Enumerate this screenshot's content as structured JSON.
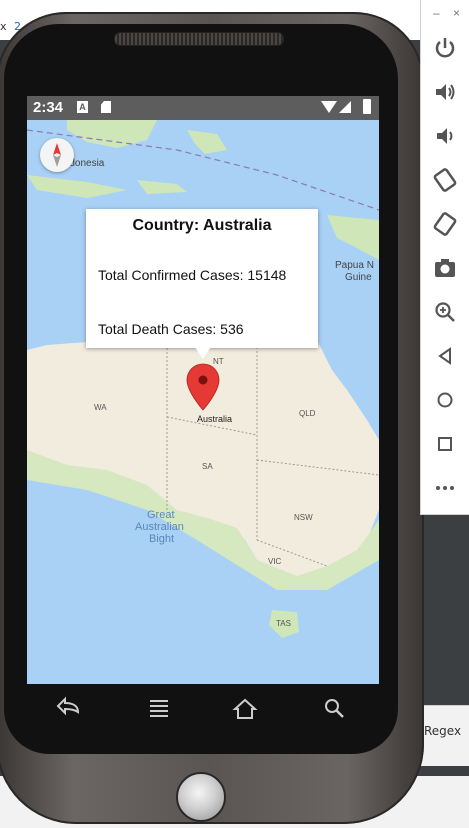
{
  "ide": {
    "tab_fragment_left": "x",
    "tab_fragment_right": "2",
    "search_option_label": "Regex"
  },
  "toolbar": {
    "minimize_label": "–",
    "close_label": "×",
    "buttons": [
      {
        "icon": "power-icon"
      },
      {
        "icon": "volume-up-icon"
      },
      {
        "icon": "volume-down-icon"
      },
      {
        "icon": "rotate-left-icon"
      },
      {
        "icon": "rotate-right-icon"
      },
      {
        "icon": "camera-icon"
      },
      {
        "icon": "zoom-icon"
      },
      {
        "icon": "back-icon"
      },
      {
        "icon": "home-icon"
      },
      {
        "icon": "overview-icon"
      },
      {
        "icon": "more-icon"
      }
    ]
  },
  "status_bar": {
    "time": "2:34",
    "notification_icon_text": "A"
  },
  "map": {
    "labels": {
      "indonesia": "Indonesia",
      "papua_new_guinea": "Papua N\nGuine",
      "wa": "WA",
      "nt": "NT",
      "qld": "QLD",
      "sa": "SA",
      "nsw": "NSW",
      "vic": "VIC",
      "tas": "TAS",
      "great_australian_bight": "Great\nAustralian\nBight",
      "marker": "Australia"
    },
    "colors": {
      "water": "#a8d1f5",
      "land": "#f2ecdf",
      "green": "#cfe6b8",
      "marker": "#e53935"
    }
  },
  "info_window": {
    "title": "Country: Australia",
    "confirmed": "Total Confirmed Cases: 15148",
    "deaths": "Total Death Cases: 536"
  },
  "nav_bar": {
    "buttons": [
      "back-icon",
      "menu-icon",
      "home-icon",
      "search-icon"
    ]
  }
}
